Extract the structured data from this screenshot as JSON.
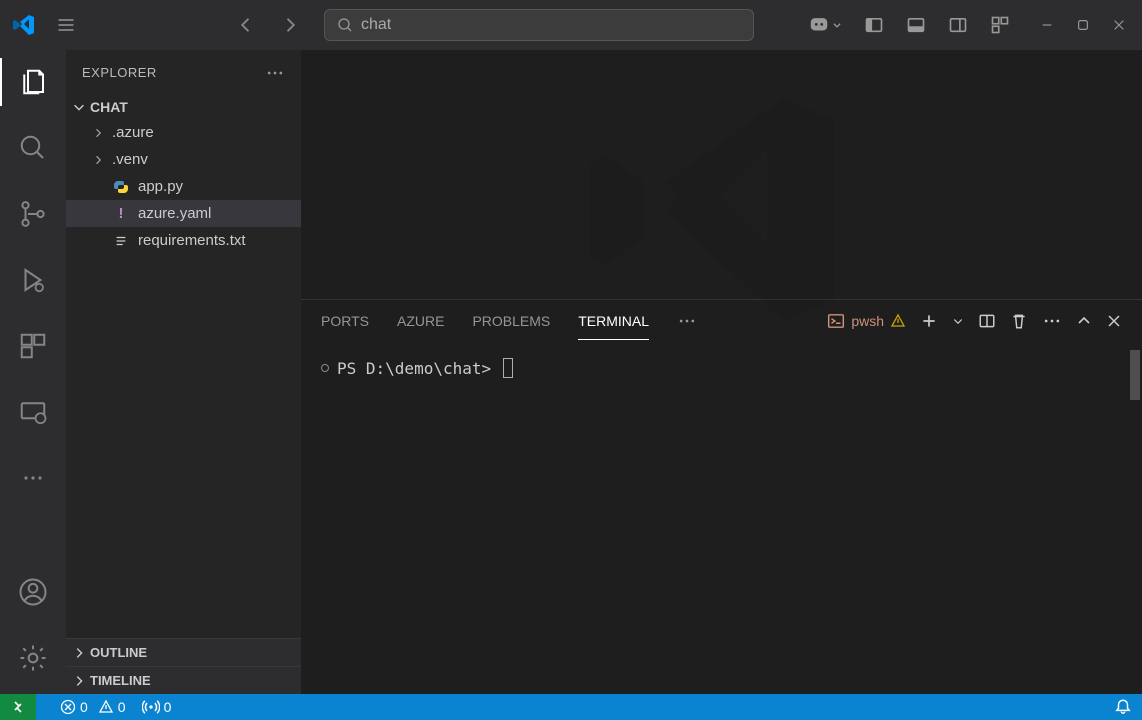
{
  "titlebar": {
    "search_text": "chat"
  },
  "sidebar": {
    "title": "EXPLORER",
    "folder_name": "CHAT",
    "items": [
      {
        "label": ".azure",
        "type": "folder"
      },
      {
        "label": ".venv",
        "type": "folder"
      },
      {
        "label": "app.py",
        "type": "py"
      },
      {
        "label": "azure.yaml",
        "type": "yaml"
      },
      {
        "label": "requirements.txt",
        "type": "txt"
      }
    ],
    "sections": [
      {
        "label": "OUTLINE"
      },
      {
        "label": "TIMELINE"
      }
    ]
  },
  "panel": {
    "tabs": [
      {
        "label": "PORTS"
      },
      {
        "label": "AZURE"
      },
      {
        "label": "PROBLEMS"
      },
      {
        "label": "TERMINAL"
      }
    ],
    "shell_label": "pwsh",
    "prompt": "PS D:\\demo\\chat>"
  },
  "statusbar": {
    "errors": "0",
    "warnings": "0",
    "ports": "0"
  }
}
